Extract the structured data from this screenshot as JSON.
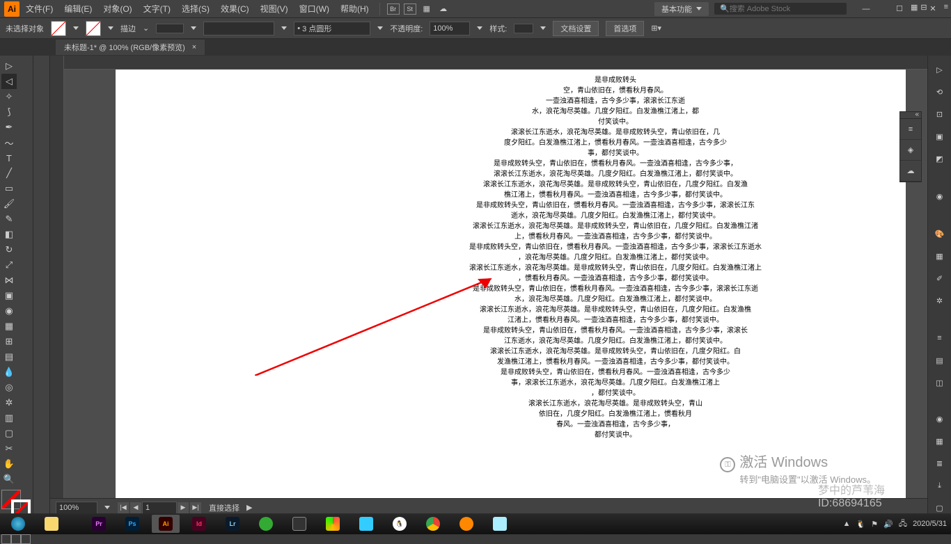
{
  "menubar": {
    "items": [
      "文件(F)",
      "编辑(E)",
      "对象(O)",
      "文字(T)",
      "选择(S)",
      "效果(C)",
      "视图(V)",
      "窗口(W)",
      "帮助(H)"
    ],
    "icons": [
      "Br",
      "St",
      "☰",
      "☁"
    ],
    "basic": "基本功能",
    "search_placeholder": "搜索 Adobe Stock"
  },
  "ctrl": {
    "noselect": "未选择对象",
    "stroke_label": "描边",
    "stroke_value": "",
    "size_value": "3 点圆形",
    "opacity_label": "不透明度:",
    "opacity_value": "100%",
    "style_label": "样式:",
    "docset": "文档设置",
    "prefs": "首选项"
  },
  "tab": {
    "title": "未标题-1* @ 100% (RGB/像素预览)"
  },
  "status": {
    "zoom": "100%",
    "page": "1",
    "mode": "直接选择"
  },
  "watermark": {
    "line1": "激活 Windows",
    "line2": "转到\"电脑设置\"以激活 Windows。"
  },
  "bottom_wm": {
    "line1": "梦中的芦苇海",
    "line2": "ID:68694165"
  },
  "task": {
    "time": "2020/5/31"
  },
  "poem_lines": [
    "是非成败转头",
    "空，青山依旧在，惯看秋月春风。",
    "一壶浊酒喜相逢，古今多少事，滚滚长江东逝",
    "水，浪花淘尽英雄。几度夕阳红。白发渔樵江渚上，都",
    "付笑谈中。",
    "滚滚长江东逝水，浪花淘尽英雄。是非成败转头空，青山依旧在，几",
    "度夕阳红。白发渔樵江渚上，惯看秋月春风。一壶浊酒喜相逢，古今多少",
    "事，都付笑谈中。",
    "是非成败转头空，青山依旧在，惯看秋月春风。一壶浊酒喜相逢，古今多少事，",
    "滚滚长江东逝水，浪花淘尽英雄。几度夕阳红。白发渔樵江渚上，都付笑谈中。",
    "滚滚长江东逝水，浪花淘尽英雄。是非成败转头空，青山依旧在，几度夕阳红。白发渔",
    "樵江渚上，惯看秋月春风。一壶浊酒喜相逢，古今多少事，都付笑谈中。",
    "是非成败转头空，青山依旧在，惯看秋月春风。一壶浊酒喜相逢，古今多少事，滚滚长江东",
    "逝水，浪花淘尽英雄。几度夕阳红。白发渔樵江渚上，都付笑谈中。",
    "滚滚长江东逝水，浪花淘尽英雄。是非成败转头空，青山依旧在，几度夕阳红。白发渔樵江渚",
    "上，惯看秋月春风。一壶浊酒喜相逢，古今多少事，都付笑谈中。",
    "是非成败转头空，青山依旧在，惯看秋月春风。一壶浊酒喜相逢，古今多少事，滚滚长江东逝水",
    "，浪花淘尽英雄。几度夕阳红。白发渔樵江渚上，都付笑谈中。",
    "滚滚长江东逝水，浪花淘尽英雄。是非成败转头空，青山依旧在，几度夕阳红。白发渔樵江渚上",
    "，惯看秋月春风。一壶浊酒喜相逢，古今多少事，都付笑谈中。",
    "是非成败转头空，青山依旧在，惯看秋月春风。一壶浊酒喜相逢，古今多少事，滚滚长江东逝",
    "水，浪花淘尽英雄。几度夕阳红。白发渔樵江渚上，都付笑谈中。",
    "滚滚长江东逝水，浪花淘尽英雄。是非成败转头空，青山依旧在，几度夕阳红。白发渔樵",
    "江渚上，惯看秋月春风。一壶浊酒喜相逢，古今多少事，都付笑谈中。",
    "是非成败转头空，青山依旧在，惯看秋月春风。一壶浊酒喜相逢，古今多少事，滚滚长",
    "江东逝水，浪花淘尽英雄。几度夕阳红。白发渔樵江渚上，都付笑谈中。",
    "滚滚长江东逝水，浪花淘尽英雄。是非成败转头空，青山依旧在，几度夕阳红。白",
    "发渔樵江渚上，惯看秋月春风。一壶浊酒喜相逢，古今多少事，都付笑谈中。",
    "是非成败转头空，青山依旧在，惯看秋月春风。一壶浊酒喜相逢，古今多少",
    "事，滚滚长江东逝水，浪花淘尽英雄。几度夕阳红。白发渔樵江渚上",
    "，都付笑谈中。",
    "滚滚长江东逝水，浪花淘尽英雄。是非成败转头空，青山",
    "依旧在，几度夕阳红。白发渔樵江渚上，惯看秋月",
    "春风。一壶浊酒喜相逢，古今多少事，",
    "都付笑谈中。"
  ]
}
